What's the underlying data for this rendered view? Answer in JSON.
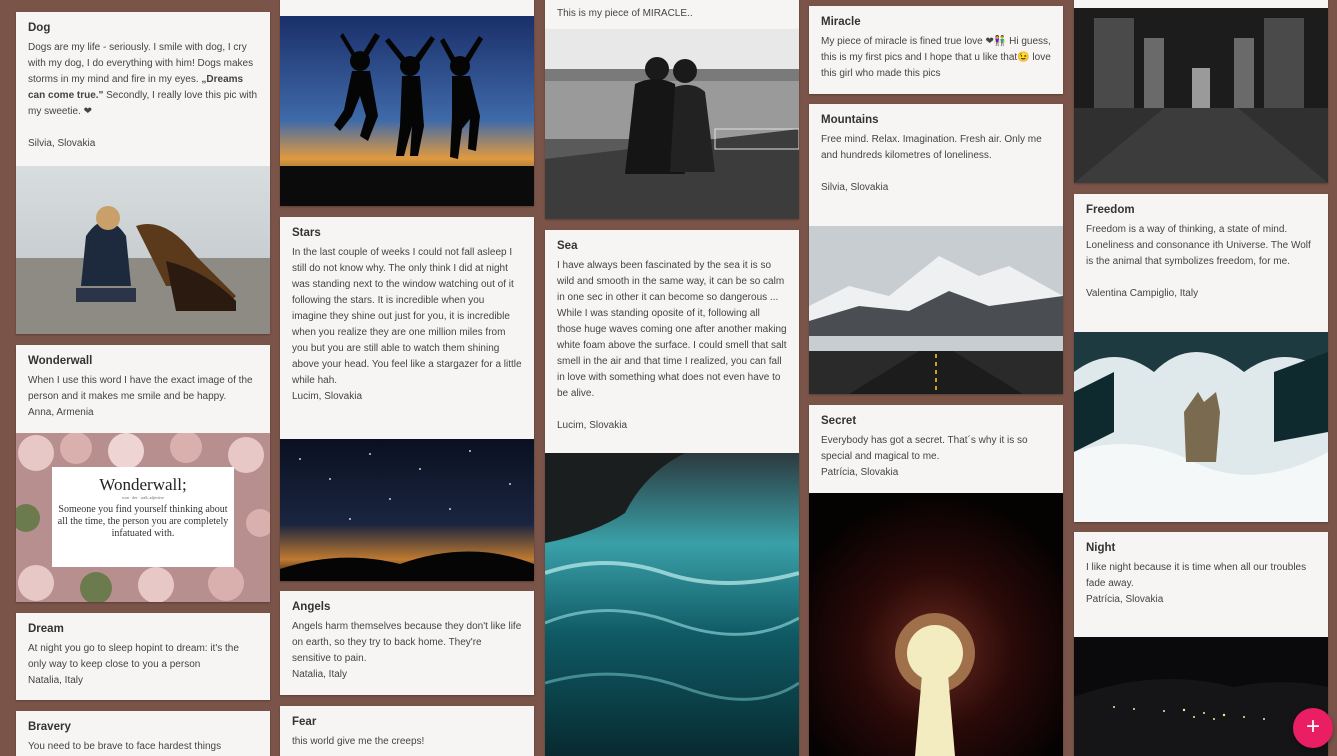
{
  "cards": {
    "dog": {
      "title": "Dog",
      "body_a": "Dogs are my life - seriously. I smile with dog, I cry with my dog, I do everything with him! Dogs makes storms in my mind and fire in my eyes. ",
      "body_bold": "„Dreams can come true.\"",
      "body_b": " Secondly, I really love this pic with my sweetie. ❤",
      "author": "Silvia, Slovakia"
    },
    "wonderwall": {
      "title": "Wonderwall",
      "body": "When I use this word I have the exact image of the person and it makes me smile and be happy.",
      "author": "Anna, Armenia",
      "image_heading": "Wonderwall;",
      "image_sub": "won · der · wall, adjective",
      "image_quote": "Someone you find yourself thinking about all the time, the person you are completely infatuated with."
    },
    "dream": {
      "title": "Dream",
      "body": "At night you go to sleep hopint to dream: it's the only way to keep close to you a person",
      "author": "Natalia, Italy"
    },
    "bravery": {
      "title": "Bravery",
      "body": "You need to be brave to face hardest things"
    },
    "stars": {
      "title": "Stars",
      "body": "In the last couple of weeks I could not fall asleep I still do not know why. The only think I did at night was standing next to the window watching out of it following the stars. It is incredible when you imagine they shine out just for you, it is incredible when you realize they are one million miles from you but you are still able to watch them shining above your head. You feel like a stargazer for a little while hah.",
      "author": "Lucim, Slovakia"
    },
    "angels": {
      "title": "Angels",
      "body": "Angels harm themselves because they don't like life on earth, so they try to back home. They're sensitive to pain.",
      "author": "Natalia, Italy"
    },
    "fear": {
      "title": "Fear",
      "body": "this world give me the creeps!"
    },
    "miracle_top": {
      "body": "This is my piece of MIRACLE.."
    },
    "sea": {
      "title": "Sea",
      "body": "I have always been fascinated by the sea it is so wild and smooth in the same way, it can be so calm in one sec in other it can become so dangerous  ... While I was standing oposite of it, following all those huge waves coming one after another making white foam above the surface. I could smell that salt smell in the air and that time I realized, you can fall in love with something what does not even have to be alive.",
      "author": "Lucim, Slovakia"
    },
    "miracle": {
      "title": "Miracle",
      "body": "My piece of miracle is fined true love ❤👫 Hi guess, this is my first pics and I hope that u like that😉 love this girl who made this pics"
    },
    "mountains": {
      "title": "Mountains",
      "body": "Free mind. Relax. Imagination. Fresh air. Only me and hundreds kilometres of loneliness.",
      "author": "Silvia, Slovakia"
    },
    "secret": {
      "title": "Secret",
      "body": "Everybody has got a secret. That´s why it is so special and magical to me.",
      "author": "Patrícia, Slovakia"
    },
    "freedom": {
      "title": "Freedom",
      "body": "Freedom is a way of thinking, a state of mind. Loneliness and consonance ith Universe. The Wolf is the animal that symbolizes freedom, for me.",
      "author": "Valentina Campiglio, Italy"
    },
    "night": {
      "title": "Night",
      "body": "I like night because it is time when all our troubles fade away.",
      "author": "Patrícia, Slovakia"
    }
  },
  "fab": {
    "label": "+"
  },
  "colors": {
    "background": "#7a5448",
    "card": "#f7f5f3",
    "fab": "#e91e63"
  }
}
